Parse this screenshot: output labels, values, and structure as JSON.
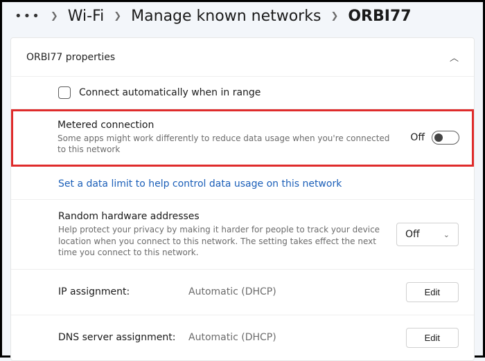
{
  "breadcrumb": {
    "item1": "Wi-Fi",
    "item2": "Manage known networks",
    "item3": "ORBI77"
  },
  "panel": {
    "title": "ORBI77 properties"
  },
  "auto_connect": {
    "label": "Connect automatically when in range"
  },
  "metered": {
    "title": "Metered connection",
    "desc": "Some apps might work differently to reduce data usage when you're connected to this network",
    "state": "Off"
  },
  "data_limit_link": "Set a data limit to help control data usage on this network",
  "random_hw": {
    "title": "Random hardware addresses",
    "desc": "Help protect your privacy by making it harder for people to track your device location when you connect to this network. The setting takes effect the next time you connect to this network.",
    "value": "Off"
  },
  "ip_assignment": {
    "label": "IP assignment:",
    "value": "Automatic (DHCP)",
    "button": "Edit"
  },
  "dns_assignment": {
    "label": "DNS server assignment:",
    "value": "Automatic (DHCP)",
    "button": "Edit"
  }
}
